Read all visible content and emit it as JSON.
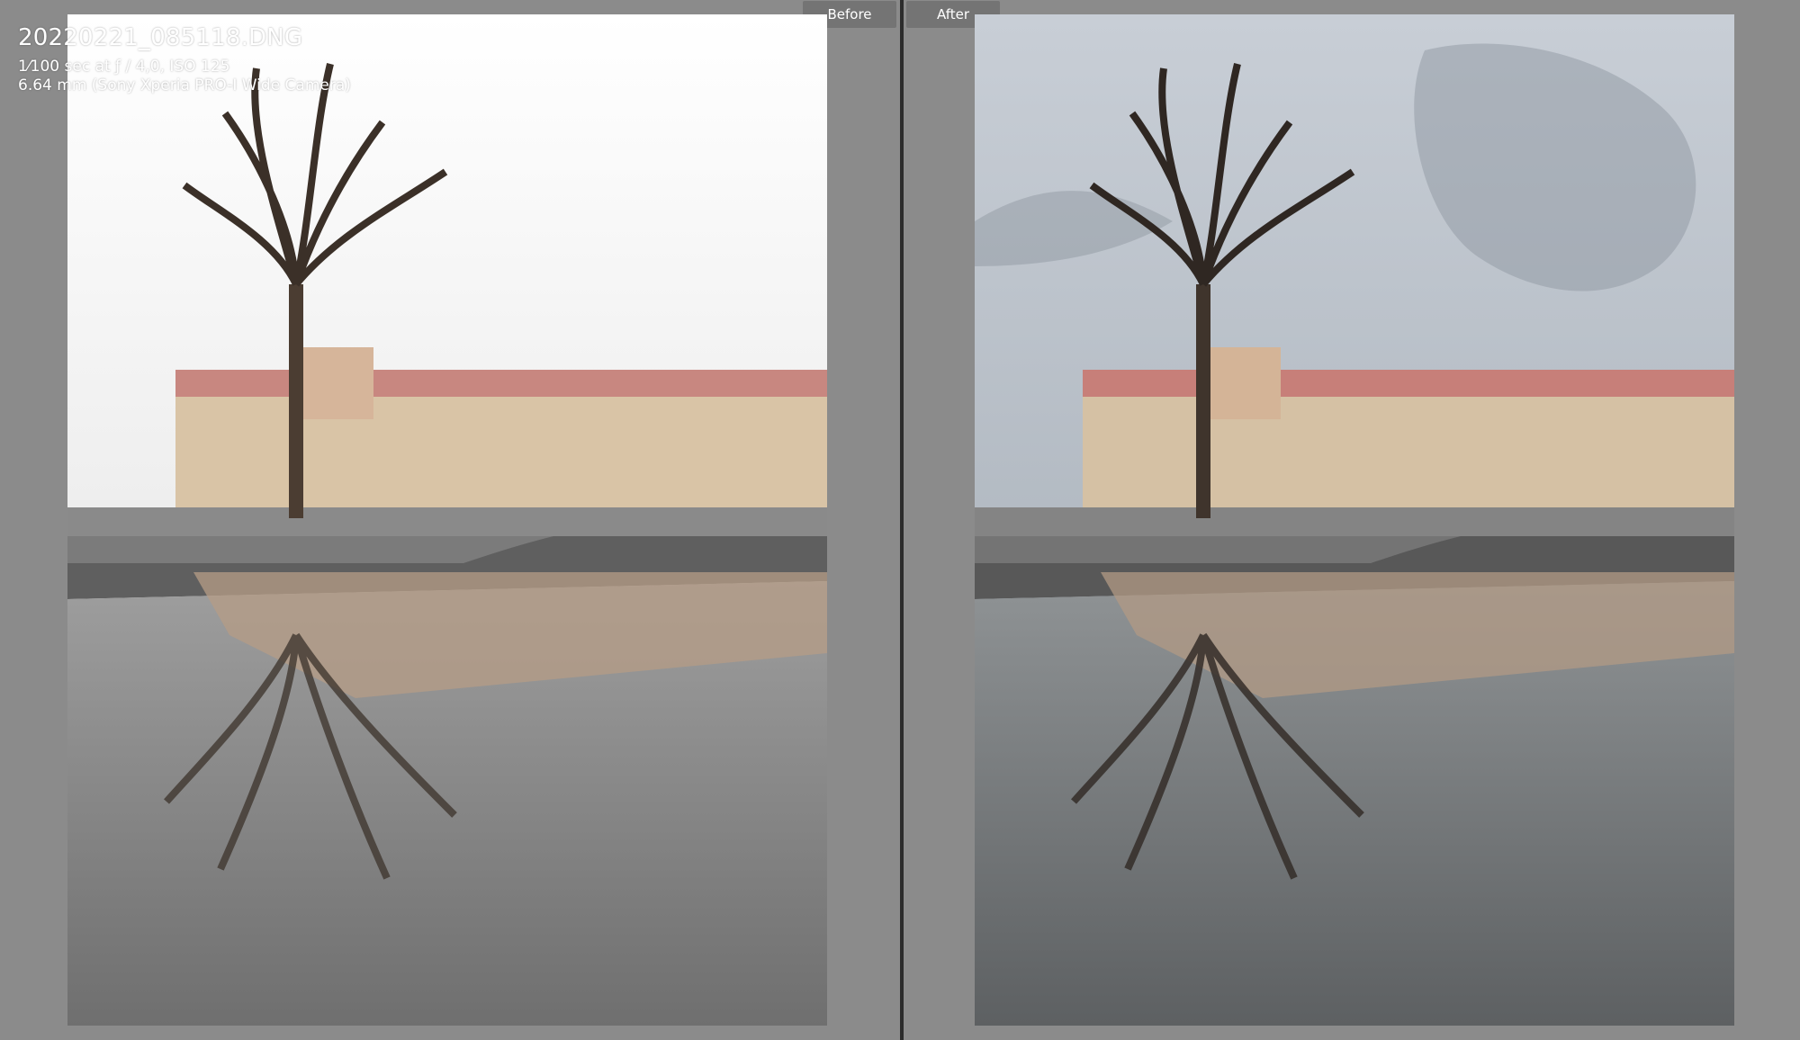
{
  "photo_info": {
    "filename": "20220221_085118.DNG",
    "exposure": "1⁄100 sec at ƒ / 4,0, ISO 125",
    "lens": "6.64 mm (Sony Xperia PRO-I Wide Camera)"
  },
  "views": {
    "before_label": "Before",
    "after_label": "After"
  },
  "colors": {
    "background": "#8b8b8b",
    "divider": "#2c2c2c",
    "tab": "#747474",
    "sky_before": "#f2f2f2",
    "sky_after": "#b9c2cb"
  },
  "icons": {
    "split_view": "split-view-icon"
  }
}
